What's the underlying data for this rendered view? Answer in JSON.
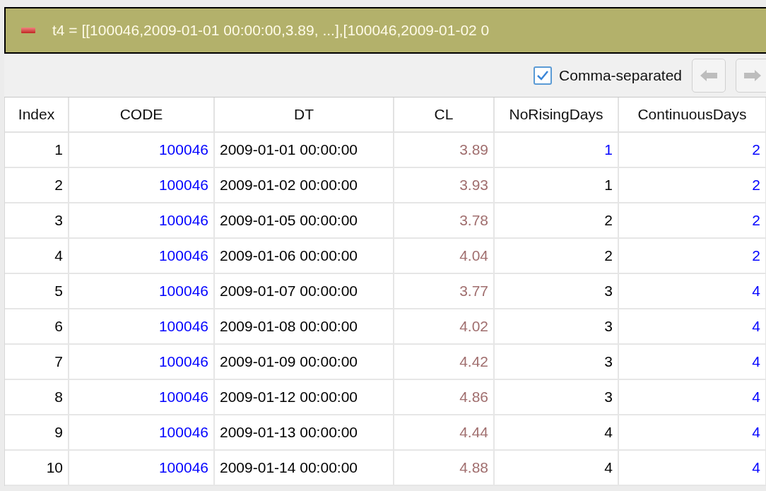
{
  "title_bar": {
    "text": "t4 = [[100046,2009-01-01 00:00:00,3.89, ...],[100046,2009-01-02 0"
  },
  "toolbar": {
    "checkbox": {
      "label": "Comma-separated",
      "checked": true
    }
  },
  "table": {
    "columns": [
      "Index",
      "CODE",
      "DT",
      "CL",
      "NoRisingDays",
      "ContinuousDays"
    ],
    "rows": [
      [
        {
          "text": "1",
          "color": "#000000"
        },
        {
          "text": "100046",
          "color": "#0000ff"
        },
        {
          "text": "2009-01-01 00:00:00",
          "color": "#000000"
        },
        {
          "text": "3.89",
          "color": "#a06e6e"
        },
        {
          "text": "1",
          "color": "#0000ff"
        },
        {
          "text": "2",
          "color": "#0000ff"
        }
      ],
      [
        {
          "text": "2",
          "color": "#000000"
        },
        {
          "text": "100046",
          "color": "#0000ff"
        },
        {
          "text": "2009-01-02 00:00:00",
          "color": "#000000"
        },
        {
          "text": "3.93",
          "color": "#a06e6e"
        },
        {
          "text": "1",
          "color": "#000000"
        },
        {
          "text": "2",
          "color": "#0000ff"
        }
      ],
      [
        {
          "text": "3",
          "color": "#000000"
        },
        {
          "text": "100046",
          "color": "#0000ff"
        },
        {
          "text": "2009-01-05 00:00:00",
          "color": "#000000"
        },
        {
          "text": "3.78",
          "color": "#a06e6e"
        },
        {
          "text": "2",
          "color": "#000000"
        },
        {
          "text": "2",
          "color": "#0000ff"
        }
      ],
      [
        {
          "text": "4",
          "color": "#000000"
        },
        {
          "text": "100046",
          "color": "#0000ff"
        },
        {
          "text": "2009-01-06 00:00:00",
          "color": "#000000"
        },
        {
          "text": "4.04",
          "color": "#a06e6e"
        },
        {
          "text": "2",
          "color": "#000000"
        },
        {
          "text": "2",
          "color": "#0000ff"
        }
      ],
      [
        {
          "text": "5",
          "color": "#000000"
        },
        {
          "text": "100046",
          "color": "#0000ff"
        },
        {
          "text": "2009-01-07 00:00:00",
          "color": "#000000"
        },
        {
          "text": "3.77",
          "color": "#a06e6e"
        },
        {
          "text": "3",
          "color": "#000000"
        },
        {
          "text": "4",
          "color": "#0000ff"
        }
      ],
      [
        {
          "text": "6",
          "color": "#000000"
        },
        {
          "text": "100046",
          "color": "#0000ff"
        },
        {
          "text": "2009-01-08 00:00:00",
          "color": "#000000"
        },
        {
          "text": "4.02",
          "color": "#a06e6e"
        },
        {
          "text": "3",
          "color": "#000000"
        },
        {
          "text": "4",
          "color": "#0000ff"
        }
      ],
      [
        {
          "text": "7",
          "color": "#000000"
        },
        {
          "text": "100046",
          "color": "#0000ff"
        },
        {
          "text": "2009-01-09 00:00:00",
          "color": "#000000"
        },
        {
          "text": "4.42",
          "color": "#a06e6e"
        },
        {
          "text": "3",
          "color": "#000000"
        },
        {
          "text": "4",
          "color": "#0000ff"
        }
      ],
      [
        {
          "text": "8",
          "color": "#000000"
        },
        {
          "text": "100046",
          "color": "#0000ff"
        },
        {
          "text": "2009-01-12 00:00:00",
          "color": "#000000"
        },
        {
          "text": "4.86",
          "color": "#a06e6e"
        },
        {
          "text": "3",
          "color": "#000000"
        },
        {
          "text": "4",
          "color": "#0000ff"
        }
      ],
      [
        {
          "text": "9",
          "color": "#000000"
        },
        {
          "text": "100046",
          "color": "#0000ff"
        },
        {
          "text": "2009-01-13 00:00:00",
          "color": "#000000"
        },
        {
          "text": "4.44",
          "color": "#a06e6e"
        },
        {
          "text": "4",
          "color": "#000000"
        },
        {
          "text": "4",
          "color": "#0000ff"
        }
      ],
      [
        {
          "text": "10",
          "color": "#000000"
        },
        {
          "text": "100046",
          "color": "#0000ff"
        },
        {
          "text": "2009-01-14 00:00:00",
          "color": "#000000"
        },
        {
          "text": "4.88",
          "color": "#a06e6e"
        },
        {
          "text": "4",
          "color": "#000000"
        },
        {
          "text": "4",
          "color": "#0000ff"
        }
      ]
    ]
  }
}
